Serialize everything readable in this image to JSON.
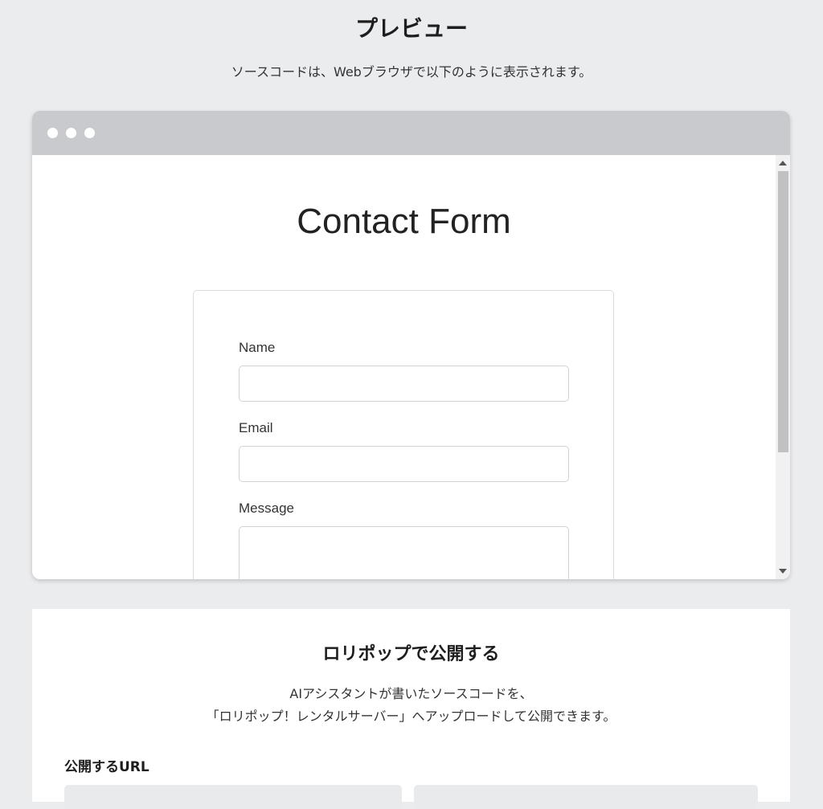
{
  "header": {
    "title": "プレビュー",
    "subtitle": "ソースコードは、Webブラウザで以下のように表示されます。"
  },
  "preview": {
    "form_title": "Contact Form",
    "fields": [
      {
        "label": "Name",
        "value": ""
      },
      {
        "label": "Email",
        "value": ""
      },
      {
        "label": "Message",
        "value": ""
      }
    ]
  },
  "publish": {
    "title": "ロリポップで公開する",
    "desc_line1": "AIアシスタントが書いたソースコードを、",
    "desc_line2": "「ロリポップ！レンタルサーバー」へアップロードして公開できます。",
    "url_label": "公開するURL"
  }
}
